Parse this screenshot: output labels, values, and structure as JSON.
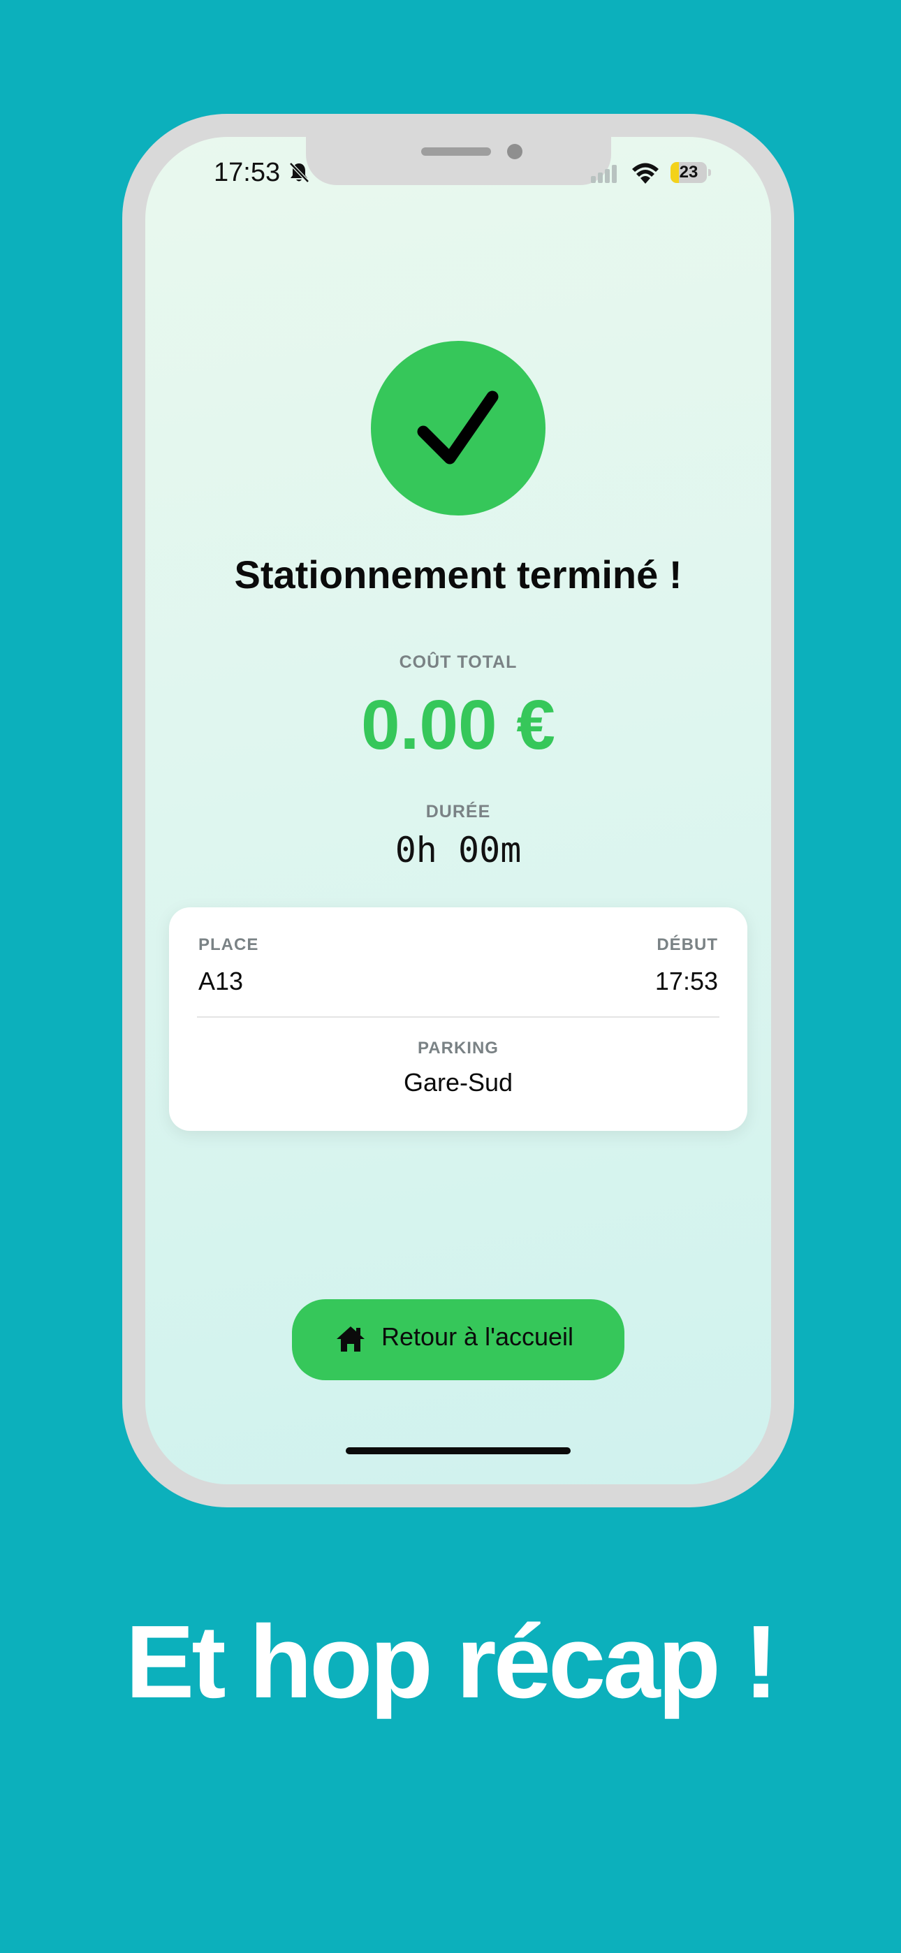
{
  "status_bar": {
    "time": "17:53",
    "battery_text": "23",
    "battery_level": 0.23
  },
  "icons": {
    "success": "checkmark-icon",
    "bell": "bell-slash-icon",
    "signal": "cellular-signal-icon",
    "wifi": "wifi-icon",
    "battery": "battery-icon",
    "home": "house-icon"
  },
  "colors": {
    "background": "#0cb0bc",
    "accent_green": "#36c75a",
    "phone_frame": "#d9d9d9"
  },
  "main": {
    "title": "Stationnement terminé !",
    "cost_label": "COÛT TOTAL",
    "cost_value": "0.00 €",
    "duration_label": "DURÉE",
    "duration_value": "0h 00m"
  },
  "card": {
    "place_label": "PLACE",
    "place_value": "A13",
    "debut_label": "DÉBUT",
    "debut_value": "17:53",
    "parking_label": "PARKING",
    "parking_value": "Gare-Sud"
  },
  "button": {
    "home_label": "Retour à l'accueil"
  },
  "caption": "Et hop récap !"
}
